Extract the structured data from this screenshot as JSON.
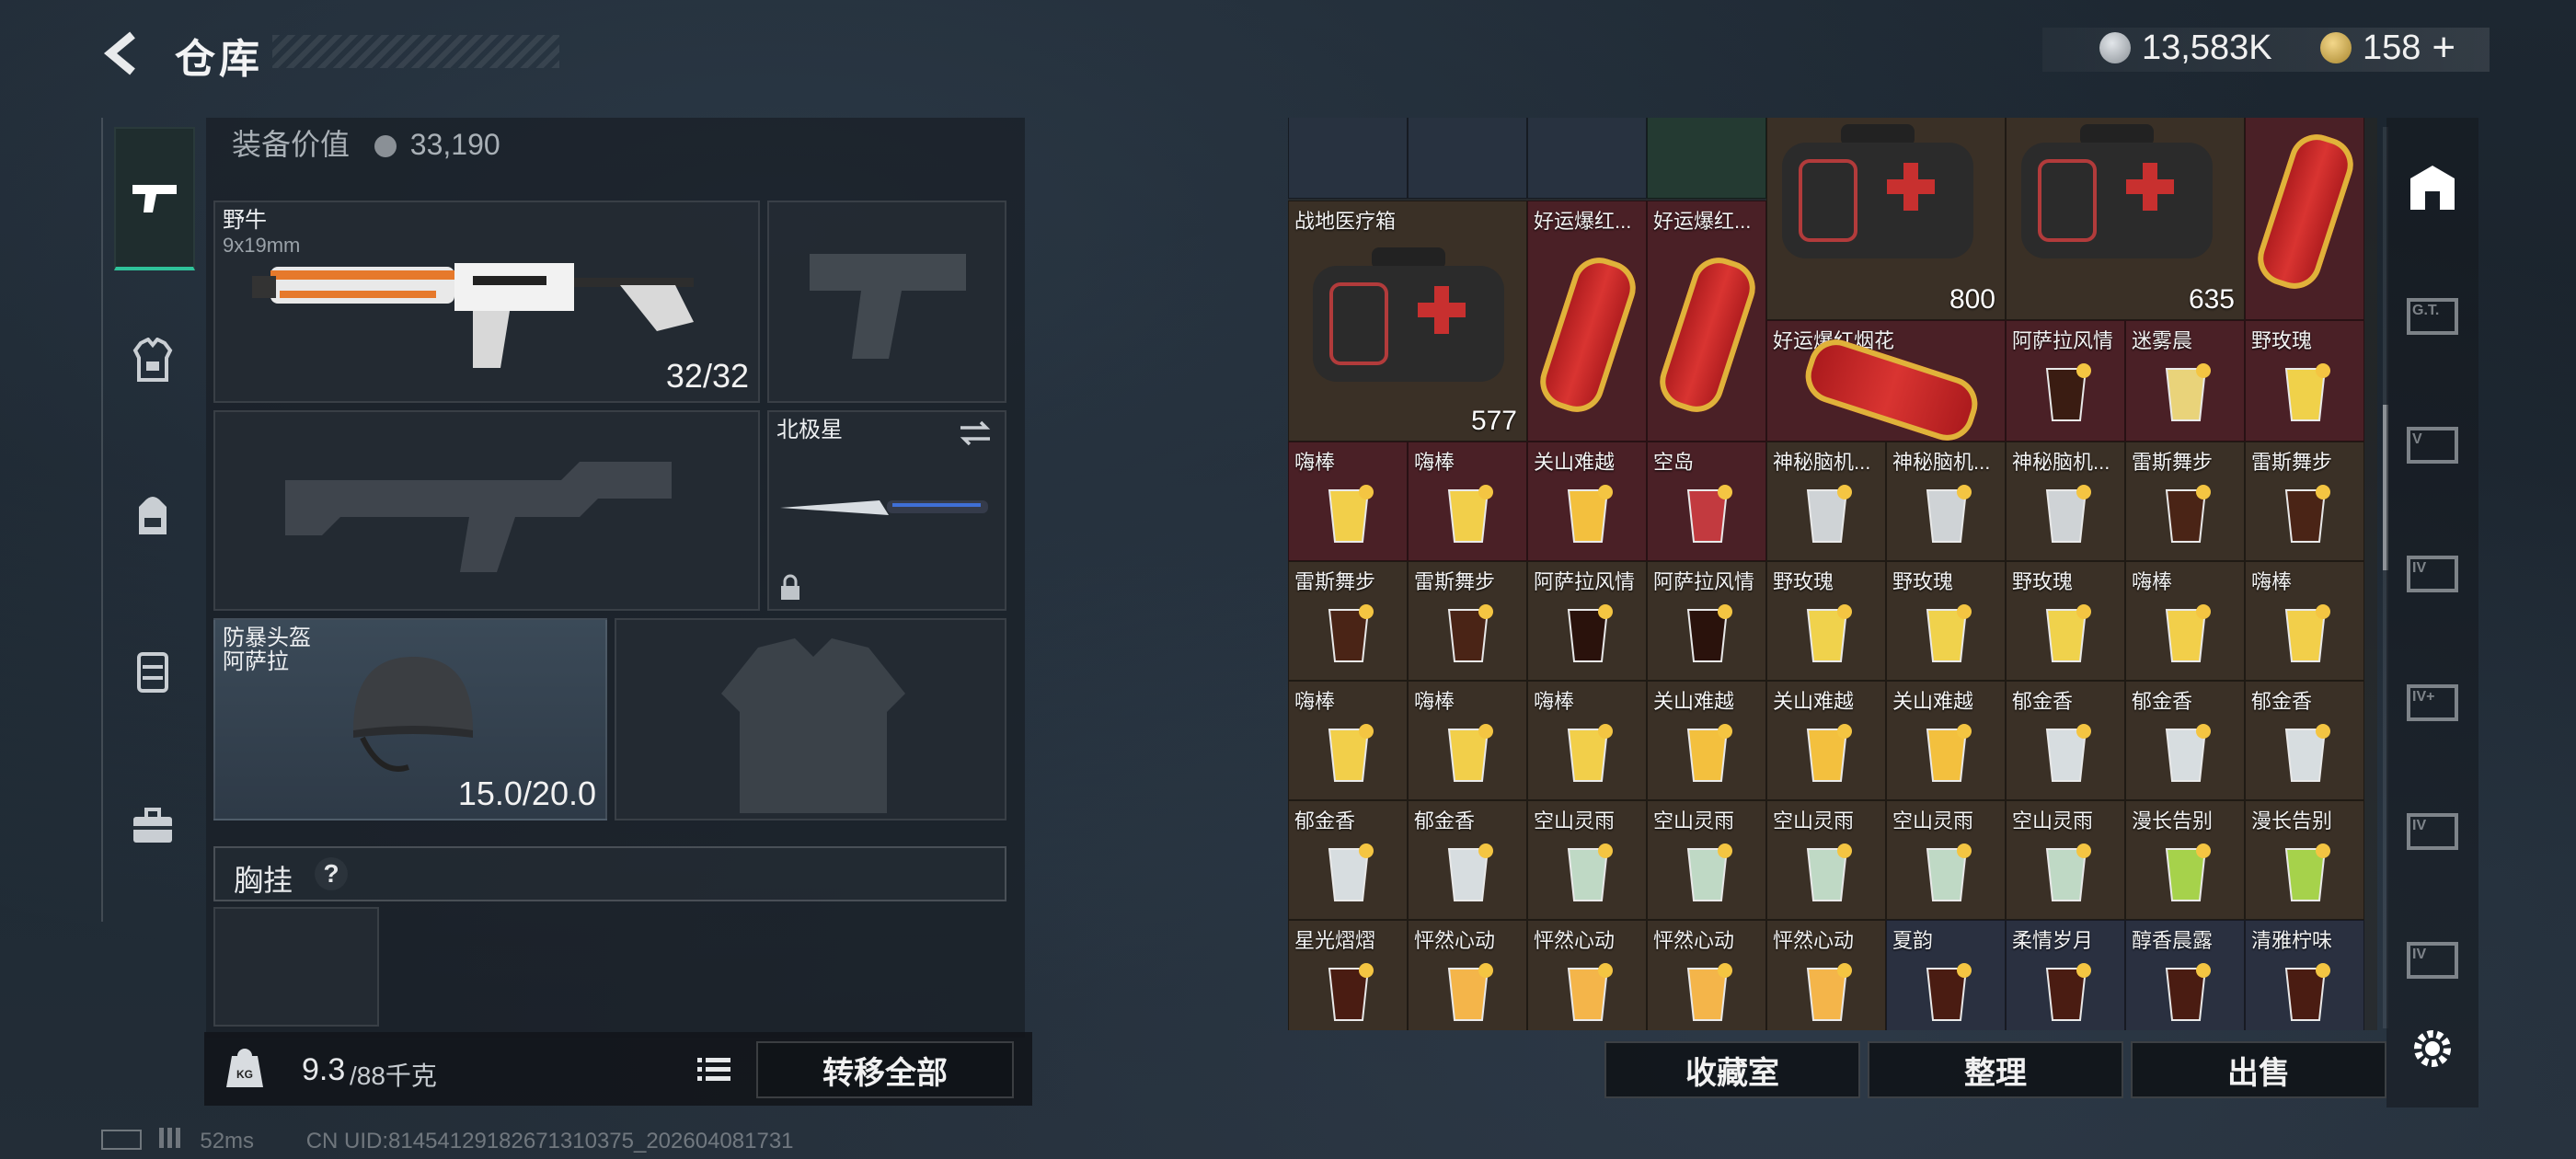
{
  "header": {
    "title": "仓库",
    "currency_1": "13,583K",
    "currency_2": "158",
    "plus": "+"
  },
  "equipment": {
    "value_label": "装备价值",
    "value": "33,190",
    "primary": {
      "name": "野牛",
      "caliber": "9x19mm",
      "ammo": "32/32"
    },
    "melee": {
      "name": "北极星"
    },
    "helmet": {
      "name": "防暴头盔",
      "map": "阿萨拉",
      "durability": "15.0/20.0"
    },
    "section_label": "胸挂",
    "section_help": "?"
  },
  "footer_left": {
    "weight": "9.3",
    "weight_max": "/88千克",
    "transfer_all": "转移全部"
  },
  "footer_right": {
    "collection": "收藏室",
    "sort": "整理",
    "sell": "出售"
  },
  "status_bar": {
    "ping": "52ms",
    "uid": "CN UID:8145412918267131​0375_202604081731"
  },
  "inventory": {
    "row_partial": [
      {
        "label": ""
      },
      {
        "label": ""
      },
      {
        "label": ""
      },
      {
        "label": ""
      }
    ],
    "medkit_1": {
      "label": "战地医疗箱",
      "value": "577"
    },
    "firecracker_1": {
      "label": "好运爆红..."
    },
    "firecracker_2": {
      "label": "好运爆红..."
    },
    "medkit_2": {
      "value": "800"
    },
    "medkit_3": {
      "value": "635"
    },
    "firecracker_big": {
      "label": "好运爆红烟花"
    },
    "r2_right": [
      "阿萨拉风情",
      "迷雾晨",
      "野玫瑰"
    ],
    "row3": [
      "嗨棒",
      "嗨棒",
      "关山难越",
      "空岛",
      "神秘脑机...",
      "神秘脑机...",
      "神秘脑机...",
      "雷斯舞步",
      "雷斯舞步"
    ],
    "row4": [
      "雷斯舞步",
      "雷斯舞步",
      "阿萨拉风情",
      "阿萨拉风情",
      "野玫瑰",
      "野玫瑰",
      "野玫瑰",
      "嗨棒",
      "嗨棒"
    ],
    "row5": [
      "嗨棒",
      "嗨棒",
      "嗨棒",
      "关山难越",
      "关山难越",
      "关山难越",
      "郁金香",
      "郁金香",
      "郁金香"
    ],
    "row6": [
      "郁金香",
      "郁金香",
      "空山灵雨",
      "空山灵雨",
      "空山灵雨",
      "空山灵雨",
      "空山灵雨",
      "漫长告别",
      "漫长告别"
    ],
    "row7": [
      "星光熠熠",
      "怦然心动",
      "怦然心动",
      "怦然心动",
      "怦然心动",
      "夏韵",
      "柔情岁月",
      "醇香晨露",
      "清雅柠味"
    ]
  },
  "rail": [
    "home-icon",
    "g-t-icon",
    "v-icon",
    "iv-icon",
    "iv-plus-icon",
    "iv-2-icon",
    "iv-3-icon",
    "settings-icon"
  ],
  "colors": {
    "accent": "#2fc29a",
    "cell_dark": "#2a2a2a",
    "cell_red": "#4a2026",
    "cell_brown": "#3a3026",
    "cell_blue": "#2a3040"
  }
}
